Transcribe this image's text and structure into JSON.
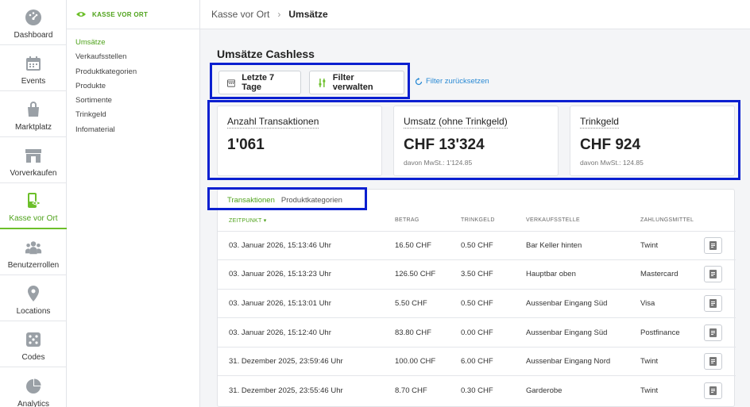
{
  "rail": {
    "items": [
      {
        "label": "Dashboard",
        "icon": "dashboard-gauge-icon"
      },
      {
        "label": "Events",
        "icon": "calendar-icon"
      },
      {
        "label": "Marktplatz",
        "icon": "shopping-bag-icon"
      },
      {
        "label": "Vorverkaufen",
        "icon": "storefront-icon"
      },
      {
        "label": "Kasse vor Ort",
        "icon": "cash-register-icon"
      },
      {
        "label": "Benutzerrollen",
        "icon": "users-icon"
      },
      {
        "label": "Locations",
        "icon": "location-pin-icon"
      },
      {
        "label": "Codes",
        "icon": "dice-icon"
      },
      {
        "label": "Analytics",
        "icon": "pie-chart-icon"
      }
    ],
    "active_index": 4
  },
  "subnav": {
    "header": "KASSE VOR ORT",
    "items": [
      "Umsätze",
      "Verkaufsstellen",
      "Produktkategorien",
      "Produkte",
      "Sortimente",
      "Trinkgeld",
      "Infomaterial"
    ],
    "active_index": 0
  },
  "breadcrumb": {
    "parent": "Kasse vor Ort",
    "separator": "›",
    "current": "Umsätze"
  },
  "page": {
    "title": "Umsätze Cashless"
  },
  "filters": {
    "date_button": "Letzte 7 Tage",
    "manage_button": "Filter verwalten",
    "reset_link": "Filter zurücksetzen"
  },
  "kpis": [
    {
      "label": "Anzahl Transaktionen",
      "value": "1'061",
      "sub": ""
    },
    {
      "label": "Umsatz (ohne Trinkgeld)",
      "value": "CHF 13'324",
      "sub": "davon MwSt.: 1'124.85"
    },
    {
      "label": "Trinkgeld",
      "value": "CHF 924",
      "sub": "davon MwSt.: 124.85"
    }
  ],
  "tabs": {
    "active": "Transaktionen",
    "other": "Produktkategorien"
  },
  "table": {
    "columns": [
      "ZEITPUNKT",
      "BETRAG",
      "TRINKGELD",
      "VERKAUFSSTELLE",
      "ZAHLUNGSMITTEL"
    ],
    "rows": [
      [
        "03. Januar 2026, 15:13:46 Uhr",
        "16.50 CHF",
        "0.50 CHF",
        "Bar Keller hinten",
        "Twint"
      ],
      [
        "03. Januar 2026, 15:13:23 Uhr",
        "126.50 CHF",
        "3.50 CHF",
        "Hauptbar oben",
        "Mastercard"
      ],
      [
        "03. Januar 2026, 15:13:01 Uhr",
        "5.50 CHF",
        "0.50 CHF",
        "Aussenbar Eingang Süd",
        "Visa"
      ],
      [
        "03. Januar 2026, 15:12:40 Uhr",
        "83.80 CHF",
        "0.00 CHF",
        "Aussenbar Eingang Süd",
        "Postfinance"
      ],
      [
        "31. Dezember 2025, 23:59:46 Uhr",
        "100.00 CHF",
        "6.00 CHF",
        "Aussenbar Eingang Nord",
        "Twint"
      ],
      [
        "31. Dezember 2025, 23:55:46 Uhr",
        "8.70 CHF",
        "0.30 CHF",
        "Garderobe",
        "Twint"
      ]
    ]
  },
  "colors": {
    "accent": "#6cbf2a",
    "highlight": "#0a1fd0",
    "link": "#2a8ad4"
  }
}
